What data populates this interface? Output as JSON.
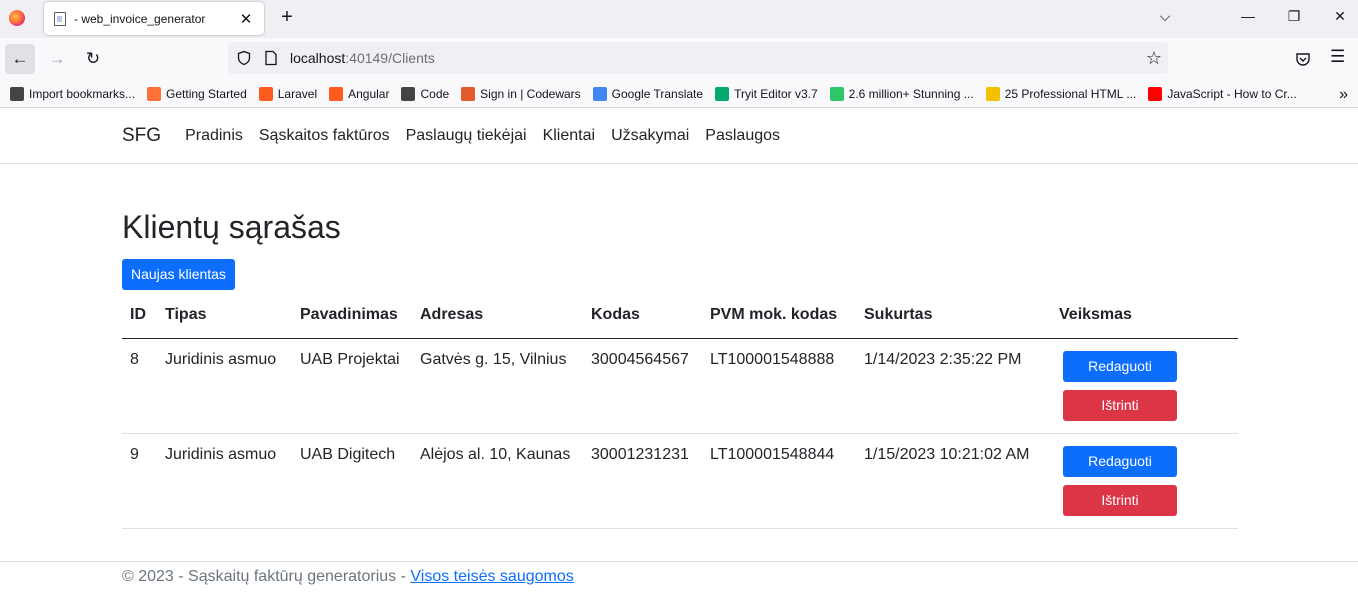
{
  "browser": {
    "tab_title": "- web_invoice_generator",
    "url_host": "localhost",
    "url_rest": ":40149/Clients",
    "bookmarks": [
      {
        "label": "Import bookmarks...",
        "icon": "import-icon",
        "color": "#444"
      },
      {
        "label": "Getting Started",
        "icon": "firefox-icon",
        "color": "#ff7139"
      },
      {
        "label": "Laravel",
        "icon": "laravel-icon",
        "color": "#ff5a1f"
      },
      {
        "label": "Angular",
        "icon": "angular-icon",
        "color": "#ff5a1f"
      },
      {
        "label": "Code",
        "icon": "folder-icon",
        "color": "#444"
      },
      {
        "label": "Sign in | Codewars",
        "icon": "codewars-icon",
        "color": "#e35a2f"
      },
      {
        "label": "Google Translate",
        "icon": "translate-icon",
        "color": "#4285f4"
      },
      {
        "label": "Tryit Editor v3.7",
        "icon": "w3-icon",
        "color": "#04aa6d"
      },
      {
        "label": "2.6 million+ Stunning ...",
        "icon": "pixabay-icon",
        "color": "#2ec66b"
      },
      {
        "label": "25 Professional HTML ...",
        "icon": "sdr-icon",
        "color": "#f2c200"
      },
      {
        "label": "JavaScript - How to Cr...",
        "icon": "youtube-icon",
        "color": "#ff0000"
      }
    ]
  },
  "app": {
    "brand": "SFG",
    "nav": [
      "Pradinis",
      "Sąskaitos faktūros",
      "Paslaugų tiekėjai",
      "Klientai",
      "Užsakymai",
      "Paslaugos"
    ],
    "page_title": "Klientų sąrašas",
    "new_button": "Naujas klientas",
    "table": {
      "headers": [
        "ID",
        "Tipas",
        "Pavadinimas",
        "Adresas",
        "Kodas",
        "PVM mok. kodas",
        "Sukurtas",
        "Veiksmas"
      ],
      "rows": [
        {
          "id": "8",
          "tipas": "Juridinis asmuo",
          "pavadinimas": "UAB Projektai",
          "adresas": "Gatvės g. 15, Vilnius",
          "kodas": "30004564567",
          "pvm": "LT100001548888",
          "sukurtas": "1/14/2023 2:35:22 PM"
        },
        {
          "id": "9",
          "tipas": "Juridinis asmuo",
          "pavadinimas": "UAB Digitech",
          "adresas": "Alėjos al. 10, Kaunas",
          "kodas": "30001231231",
          "pvm": "LT100001548844",
          "sukurtas": "1/15/2023 10:21:02 AM"
        }
      ],
      "edit_label": "Redaguoti",
      "delete_label": "Ištrinti"
    },
    "footer_text": "© 2023 - Sąskaitų faktūrų generatorius - ",
    "footer_link": "Visos teisės saugomos"
  }
}
